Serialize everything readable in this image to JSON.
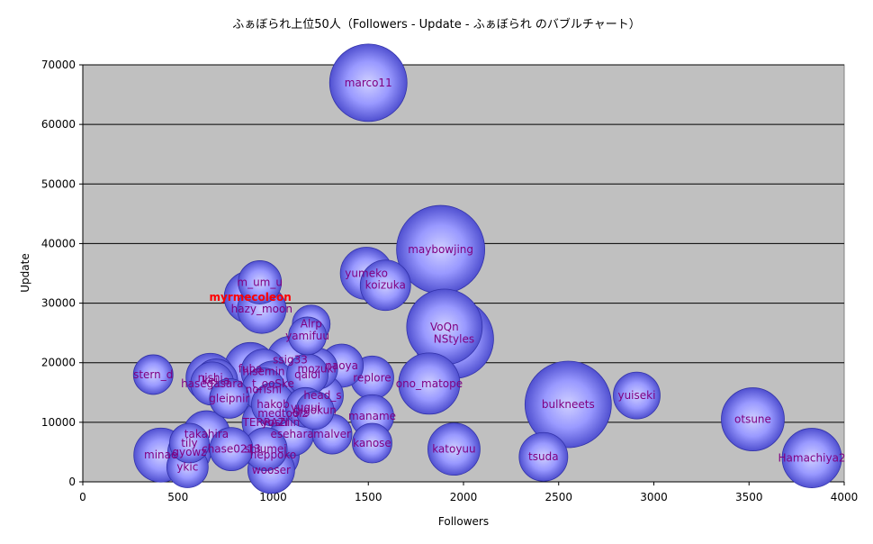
{
  "chart_data": {
    "type": "bubble",
    "title": "ふぁぼられ上位50人（Followers - Update - ふぁぼられ のバブルチャート）",
    "xlabel": "Followers",
    "ylabel": "Update",
    "xlim": [
      0,
      4000
    ],
    "ylim": [
      0,
      70000
    ],
    "xticks": [
      0,
      500,
      1000,
      1500,
      2000,
      2500,
      3000,
      3500,
      4000
    ],
    "yticks": [
      0,
      10000,
      20000,
      30000,
      40000,
      50000,
      60000,
      70000
    ],
    "plot_background": "#c0c0c0",
    "bubble_color": "#9999ff",
    "label_color": "#800080",
    "highlight_color": "#ff0000",
    "grid": "horizontal",
    "legend": "none",
    "points": [
      {
        "name": "marco11",
        "x": 1500,
        "y": 67000,
        "r": 43
      },
      {
        "name": "maybowjing",
        "x": 1880,
        "y": 39000,
        "r": 49
      },
      {
        "name": "NStyles",
        "x": 1950,
        "y": 24000,
        "r": 44
      },
      {
        "name": "VoQn",
        "x": 1900,
        "y": 26000,
        "r": 42
      },
      {
        "name": "bulkneets",
        "x": 2550,
        "y": 13000,
        "r": 48
      },
      {
        "name": "otsune",
        "x": 3520,
        "y": 10500,
        "r": 35
      },
      {
        "name": "Hamachiya2",
        "x": 3830,
        "y": 4000,
        "r": 33
      },
      {
        "name": "yuiseki",
        "x": 2910,
        "y": 14500,
        "r": 26
      },
      {
        "name": "tsuda",
        "x": 2420,
        "y": 4200,
        "r": 27
      },
      {
        "name": "katoyuu",
        "x": 1950,
        "y": 5500,
        "r": 29
      },
      {
        "name": "ono_matope",
        "x": 1820,
        "y": 16500,
        "r": 34
      },
      {
        "name": "yumeko",
        "x": 1490,
        "y": 35000,
        "r": 29
      },
      {
        "name": "koizuka",
        "x": 1590,
        "y": 33000,
        "r": 28
      },
      {
        "name": "replore",
        "x": 1520,
        "y": 17500,
        "r": 24
      },
      {
        "name": "maname",
        "x": 1520,
        "y": 11000,
        "r": 24
      },
      {
        "name": "kanose",
        "x": 1520,
        "y": 6500,
        "r": 22
      },
      {
        "name": "naoya",
        "x": 1360,
        "y": 19500,
        "r": 24
      },
      {
        "name": "head_s",
        "x": 1260,
        "y": 14500,
        "r": 23
      },
      {
        "name": "malver",
        "x": 1310,
        "y": 8000,
        "r": 22
      },
      {
        "name": "Alrp",
        "x": 1200,
        "y": 26500,
        "r": 21
      },
      {
        "name": "yamifuu",
        "x": 1180,
        "y": 24500,
        "r": 21
      },
      {
        "name": "ssig33",
        "x": 1090,
        "y": 20500,
        "r": 26
      },
      {
        "name": "mozuki",
        "x": 1230,
        "y": 19000,
        "r": 23
      },
      {
        "name": "qalol",
        "x": 1180,
        "y": 18000,
        "r": 23
      },
      {
        "name": "yugui",
        "x": 1170,
        "y": 12500,
        "r": 22
      },
      {
        "name": "gigokun",
        "x": 1220,
        "y": 12000,
        "r": 21
      },
      {
        "name": "esehara",
        "x": 1100,
        "y": 8000,
        "r": 24
      },
      {
        "name": "m_um_u",
        "x": 930,
        "y": 33500,
        "r": 24
      },
      {
        "name": "myrmecoleon",
        "x": 880,
        "y": 31000,
        "r": 29
      },
      {
        "name": "hazy_moon",
        "x": 940,
        "y": 29000,
        "r": 27
      },
      {
        "name": "fuba",
        "x": 880,
        "y": 19000,
        "r": 29
      },
      {
        "name": "hisemin",
        "x": 950,
        "y": 18500,
        "r": 25
      },
      {
        "name": "t_ooSke",
        "x": 1000,
        "y": 16500,
        "r": 25
      },
      {
        "name": "norishi",
        "x": 950,
        "y": 15500,
        "r": 24
      },
      {
        "name": "hakob",
        "x": 1000,
        "y": 13000,
        "r": 24
      },
      {
        "name": "medtoolz",
        "x": 1050,
        "y": 11500,
        "r": 26
      },
      {
        "name": "TERRAZI",
        "x": 960,
        "y": 10000,
        "r": 26
      },
      {
        "name": "yoshiin",
        "x": 1040,
        "y": 10000,
        "r": 27
      },
      {
        "name": "shiumei",
        "x": 960,
        "y": 5500,
        "r": 24
      },
      {
        "name": "heppoko",
        "x": 1000,
        "y": 4500,
        "r": 29
      },
      {
        "name": "wooser",
        "x": 990,
        "y": 2000,
        "r": 26
      },
      {
        "name": "nishi",
        "x": 670,
        "y": 17500,
        "r": 27
      },
      {
        "name": "kei_a",
        "x": 700,
        "y": 17000,
        "r": 24
      },
      {
        "name": "hasegasara",
        "x": 680,
        "y": 16500,
        "r": 24
      },
      {
        "name": "gleipnir",
        "x": 770,
        "y": 14000,
        "r": 22
      },
      {
        "name": "takahira",
        "x": 650,
        "y": 8000,
        "r": 26
      },
      {
        "name": "tily",
        "x": 560,
        "y": 6500,
        "r": 22
      },
      {
        "name": "gyowz",
        "x": 560,
        "y": 5000,
        "r": 24
      },
      {
        "name": "chase0213",
        "x": 780,
        "y": 5500,
        "r": 24
      },
      {
        "name": "minae",
        "x": 410,
        "y": 4500,
        "r": 30
      },
      {
        "name": "ykic",
        "x": 550,
        "y": 2500,
        "r": 23
      },
      {
        "name": "stern_d",
        "x": 370,
        "y": 18000,
        "r": 22
      }
    ],
    "highlight": "myrmecoleon"
  }
}
